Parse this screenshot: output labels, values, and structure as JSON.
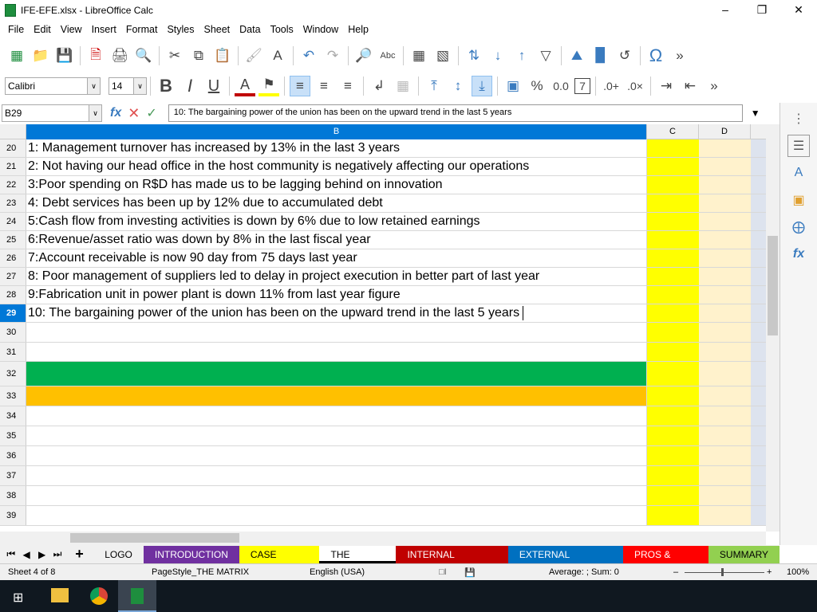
{
  "window": {
    "title": "IFE-EFE.xlsx - LibreOffice Calc"
  },
  "menu": [
    "File",
    "Edit",
    "View",
    "Insert",
    "Format",
    "Styles",
    "Sheet",
    "Data",
    "Tools",
    "Window",
    "Help"
  ],
  "format": {
    "font": "Calibri",
    "size": "14"
  },
  "formula_bar": {
    "cell_ref": "B29",
    "content": "10: The bargaining power of the union has been on the upward trend in the last 5 years"
  },
  "columns": [
    "B",
    "C",
    "D"
  ],
  "rows": [
    {
      "n": "20",
      "text": "1: Management turnover has increased by 13%  in the last 3 years"
    },
    {
      "n": "21",
      "text": "2: Not having our head office in the host community is negatively affecting our operations"
    },
    {
      "n": "22",
      "text": "3:Poor spending on R$D has  made us to be lagging behind on innovation"
    },
    {
      "n": "23",
      "text": "4: Debt services has been up by 12% due to accumulated debt"
    },
    {
      "n": "24",
      "text": "5:Cash flow from investing activities  is down by 6% due to low retained  earnings"
    },
    {
      "n": "25",
      "text": "6:Revenue/asset ratio was down by 8% in the last fiscal year"
    },
    {
      "n": "26",
      "text": "7:Account receivable is now 90 day from 75 days last year"
    },
    {
      "n": "27",
      "text": "8: Poor management of suppliers led to delay in project execution in better part of last year"
    },
    {
      "n": "28",
      "text": "9:Fabrication unit in power plant is down 11% from last year figure"
    },
    {
      "n": "29",
      "text": "10: The bargaining power of the union has been on the upward trend in the last 5 years",
      "selected": true
    },
    {
      "n": "30",
      "text": ""
    },
    {
      "n": "31",
      "text": ""
    },
    {
      "n": "32",
      "text": "",
      "fill": "#00b050"
    },
    {
      "n": "33",
      "text": "",
      "fill": "#ffc000"
    },
    {
      "n": "34",
      "text": ""
    },
    {
      "n": "35",
      "text": ""
    },
    {
      "n": "36",
      "text": ""
    },
    {
      "n": "37",
      "text": ""
    },
    {
      "n": "38",
      "text": ""
    },
    {
      "n": "39",
      "text": ""
    }
  ],
  "sheet_tabs": [
    {
      "label": "LOGO",
      "bg": "#f0f0f0",
      "fg": "#000"
    },
    {
      "label": "INTRODUCTION",
      "bg": "#7030a0",
      "fg": "#fff"
    },
    {
      "label": "CASE STUDY",
      "bg": "#ffff00",
      "fg": "#000"
    },
    {
      "label": "THE MATRIX",
      "bg": "#ffffff",
      "fg": "#000",
      "active": true
    },
    {
      "label": "INTERNAL FACTORS",
      "bg": "#c00000",
      "fg": "#fff"
    },
    {
      "label": "EXTERNAL FACTORS",
      "bg": "#0070c0",
      "fg": "#fff"
    },
    {
      "label": "PROS & CONS",
      "bg": "#ff0000",
      "fg": "#fff"
    },
    {
      "label": "SUMMARY",
      "bg": "#92d050",
      "fg": "#000"
    }
  ],
  "status": {
    "sheet": "Sheet 4 of 8",
    "page_style": "PageStyle_THE MATRIX",
    "language": "English (USA)",
    "summary": "Average: ; Sum: 0",
    "zoom": "100%"
  }
}
